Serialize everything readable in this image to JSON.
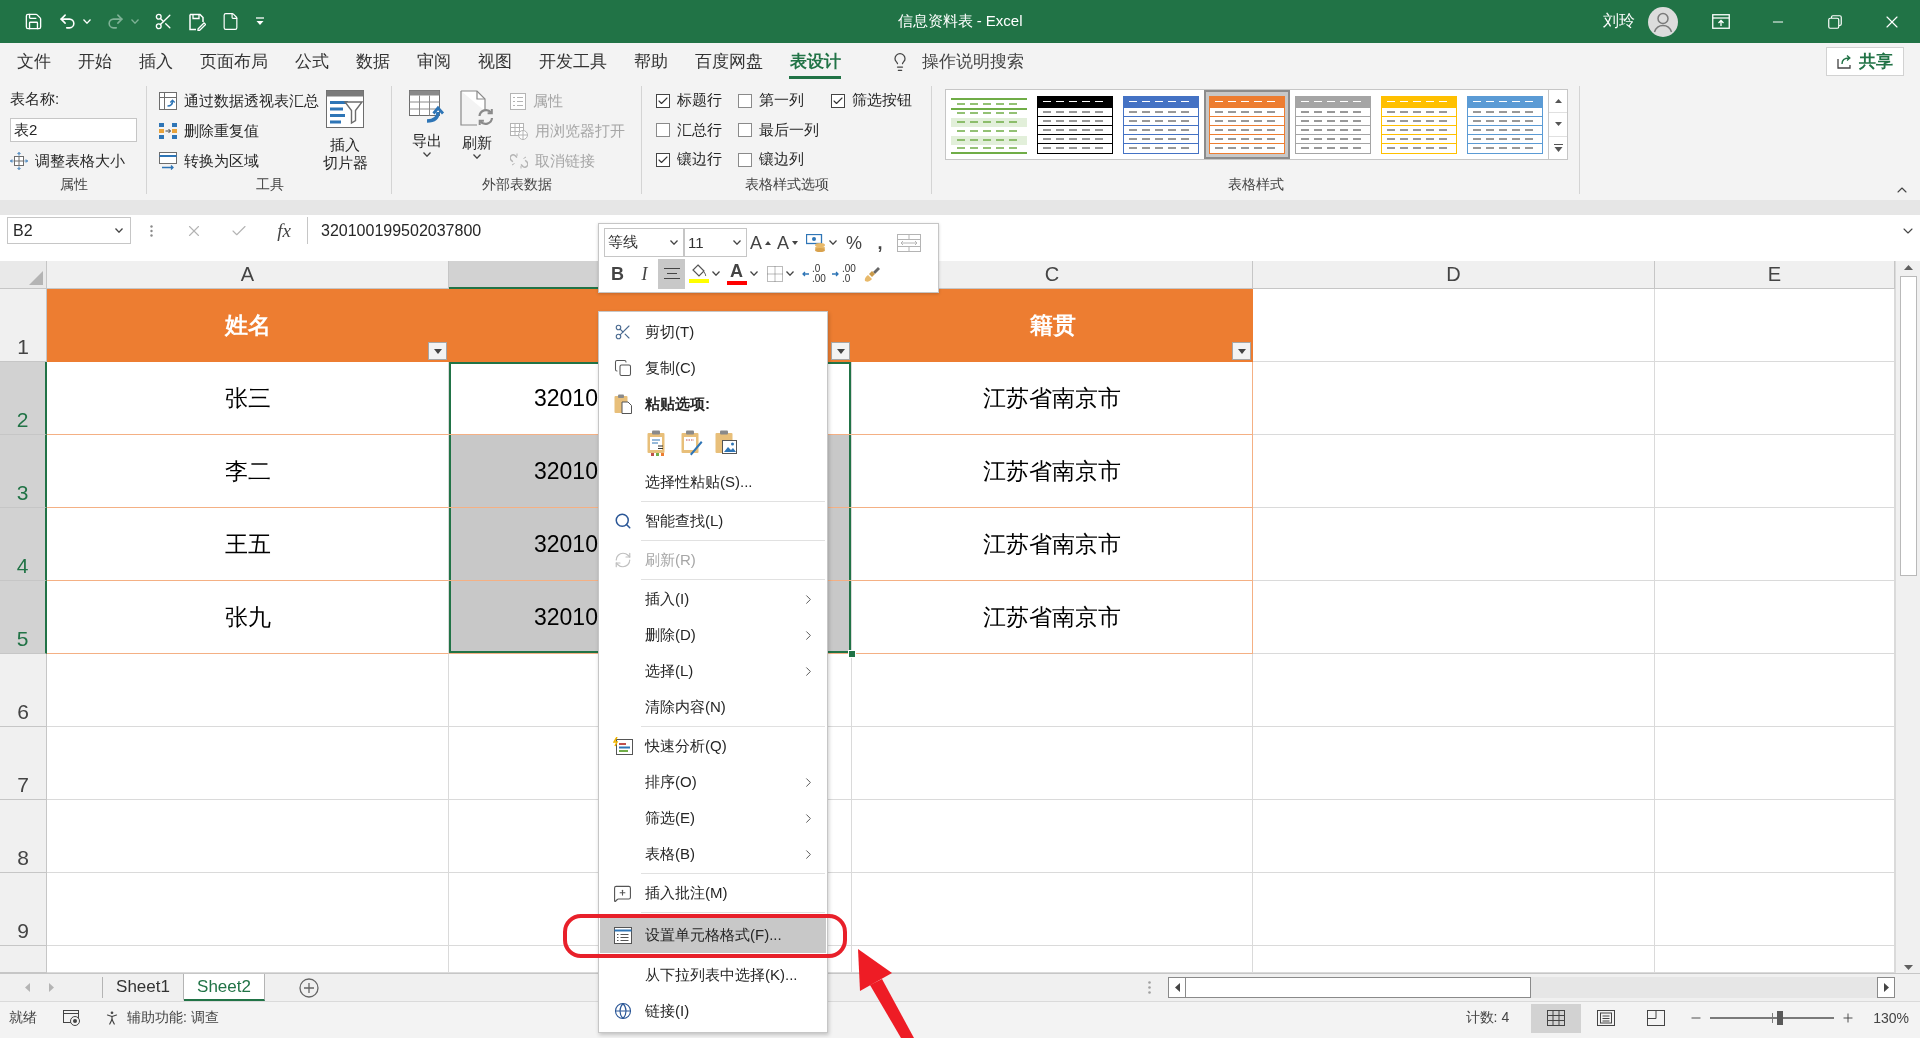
{
  "title_bar": {
    "quick_access": [
      {
        "kind": "save",
        "disabled": false
      },
      {
        "kind": "undo",
        "disabled": false
      },
      {
        "kind": "redo",
        "disabled": true
      },
      {
        "kind": "cut",
        "disabled": false
      },
      {
        "kind": "save_as",
        "disabled": false
      },
      {
        "kind": "new",
        "disabled": false
      },
      {
        "kind": "customize",
        "disabled": false
      }
    ],
    "title": "信息资料表 - Excel",
    "user": "刘玲"
  },
  "ribbon_tabs": [
    {
      "label": "文件",
      "selected": false
    },
    {
      "label": "开始",
      "selected": false
    },
    {
      "label": "插入",
      "selected": false
    },
    {
      "label": "页面布局",
      "selected": false
    },
    {
      "label": "公式",
      "selected": false
    },
    {
      "label": "数据",
      "selected": false
    },
    {
      "label": "审阅",
      "selected": false
    },
    {
      "label": "视图",
      "selected": false
    },
    {
      "label": "开发工具",
      "selected": false
    },
    {
      "label": "帮助",
      "selected": false
    },
    {
      "label": "百度网盘",
      "selected": false
    },
    {
      "label": "表设计",
      "selected": true
    }
  ],
  "tell_me": "操作说明搜索",
  "share": "共享",
  "ribbon": {
    "properties": {
      "label": "属性",
      "name_label": "表名称:",
      "name_value": "表2",
      "resize": "调整表格大小"
    },
    "tools": {
      "label": "工具",
      "buttons": [
        {
          "kind": "pivot",
          "label": "通过数据透视表汇总"
        },
        {
          "kind": "dedupe",
          "label": "删除重复值"
        },
        {
          "kind": "convert",
          "label": "转换为区域"
        }
      ],
      "slicer": [
        "插入",
        "切片器"
      ]
    },
    "external": {
      "label": "外部表数据",
      "large": [
        {
          "kind": "export",
          "label": "导出"
        },
        {
          "kind": "refresh",
          "label": "刷新"
        }
      ],
      "small": [
        {
          "kind": "properties",
          "label": "属性",
          "disabled": true
        },
        {
          "kind": "browser",
          "label": "用浏览器打开",
          "disabled": true
        },
        {
          "kind": "unlink",
          "label": "取消链接",
          "disabled": true
        }
      ]
    },
    "style_options": {
      "label": "表格样式选项",
      "columns": [
        [
          {
            "label": "标题行",
            "checked": true
          },
          {
            "label": "汇总行",
            "checked": false
          },
          {
            "label": "镶边行",
            "checked": true
          }
        ],
        [
          {
            "label": "第一列",
            "checked": false
          },
          {
            "label": "最后一列",
            "checked": false
          },
          {
            "label": "镶边列",
            "checked": false
          }
        ],
        [
          {
            "label": "筛选按钮",
            "checked": true
          }
        ]
      ]
    },
    "styles": {
      "label": "表格样式",
      "items": [
        {
          "kind": "light",
          "color": "#70ad47",
          "selected": false
        },
        {
          "kind": "medium",
          "color": "#000000",
          "selected": false
        },
        {
          "kind": "medium",
          "color": "#4472c4",
          "selected": false
        },
        {
          "kind": "medium",
          "color": "#ed7d31",
          "selected": true
        },
        {
          "kind": "medium",
          "color": "#a5a5a5",
          "selected": false
        },
        {
          "kind": "medium",
          "color": "#ffc000",
          "selected": false
        },
        {
          "kind": "medium",
          "color": "#5b9bd5",
          "selected": false
        }
      ]
    }
  },
  "formula_bar": {
    "name_box": "B2",
    "fx": "fx",
    "formula": "320100199502037800"
  },
  "mini_toolbar": {
    "font": "等线",
    "size": "11",
    "row_1": [
      {
        "kind": "grow_font",
        "text": "A"
      },
      {
        "kind": "shrink_font",
        "text": "A"
      },
      {
        "kind": "accounting"
      },
      {
        "kind": "percent",
        "text": "%"
      },
      {
        "kind": "comma",
        "text": ","
      },
      {
        "kind": "merge"
      }
    ],
    "row_2": [
      {
        "kind": "bold",
        "text": "B",
        "on": false
      },
      {
        "kind": "italic",
        "text": "I",
        "on": false
      },
      {
        "kind": "align_center",
        "on": true
      },
      {
        "kind": "fill_color",
        "color": "#ffff00",
        "on": false
      },
      {
        "kind": "font_color",
        "text": "A",
        "color": "#ff0000",
        "on": false
      },
      {
        "kind": "borders",
        "on": false
      },
      {
        "kind": "increase_decimal",
        "lines": [
          ".0",
          ".00"
        ],
        "on": false
      },
      {
        "kind": "decrease_decimal",
        "lines": [
          ".00",
          ".0"
        ],
        "on": false
      },
      {
        "kind": "format_painter",
        "on": false
      }
    ]
  },
  "sheet": {
    "columns": [
      {
        "label": "A",
        "selected": false
      },
      {
        "selected": true
      },
      {
        "label": "C",
        "selected": false
      },
      {
        "label": "D",
        "selected": false
      },
      {
        "label": "E",
        "selected": false
      }
    ],
    "row_headers": [
      {
        "label": "1",
        "selected": false
      },
      {
        "label": "2",
        "selected": true
      },
      {
        "label": "3",
        "selected": true
      },
      {
        "label": "4",
        "selected": true
      },
      {
        "label": "5",
        "selected": true
      },
      {
        "label": "6",
        "selected": false
      },
      {
        "label": "7",
        "selected": false
      },
      {
        "label": "8",
        "selected": false
      },
      {
        "label": "9",
        "selected": false
      }
    ],
    "table": {
      "header": [
        {
          "text": "姓名",
          "filter_button": true
        },
        {
          "filter_button": true
        },
        {
          "text": "籍贯",
          "filter_button": true
        }
      ],
      "rows": [
        {
          "cells": [
            {
              "text": "张三",
              "selected": false,
              "active": false
            },
            {
              "text": "32010",
              "selected": true,
              "active": true
            },
            {
              "text": "江苏省南京市",
              "selected": false,
              "active": false
            }
          ]
        },
        {
          "cells": [
            {
              "text": "李二",
              "selected": false,
              "active": false
            },
            {
              "text": "32010",
              "selected": true,
              "active": false
            },
            {
              "text": "江苏省南京市",
              "selected": false,
              "active": false
            }
          ]
        },
        {
          "cells": [
            {
              "text": "王五",
              "selected": false,
              "active": false
            },
            {
              "text": "32010",
              "selected": true,
              "active": false
            },
            {
              "text": "江苏省南京市",
              "selected": false,
              "active": false
            }
          ]
        },
        {
          "cells": [
            {
              "text": "张九",
              "selected": false,
              "active": false
            },
            {
              "text": "32010",
              "selected": true,
              "active": false
            },
            {
              "text": "江苏省南京市",
              "selected": false,
              "active": false
            }
          ]
        }
      ]
    }
  },
  "context_menu": {
    "groups": [
      [
        {
          "kind": "cut",
          "label": "剪切(T)",
          "submenu": false,
          "disabled": false,
          "selected": false
        },
        {
          "kind": "copy",
          "label": "复制(C)",
          "submenu": false,
          "disabled": false,
          "selected": false
        },
        {
          "kind": "paste_heading",
          "label": "粘贴选项:"
        },
        {
          "kind": "paste_options",
          "options": [
            {
              "kind": "values"
            },
            {
              "kind": "formatting"
            },
            {
              "kind": "picture"
            }
          ]
        },
        {
          "kind": "plain",
          "label": "选择性粘贴(S)...",
          "submenu": false,
          "disabled": false,
          "selected": false
        }
      ],
      [
        {
          "kind": "lookup",
          "label": "智能查找(L)",
          "submenu": false,
          "disabled": false,
          "selected": false
        }
      ],
      [
        {
          "kind": "refresh",
          "label": "刷新(R)",
          "submenu": false,
          "disabled": true,
          "selected": false
        }
      ],
      [
        {
          "kind": "plain",
          "label": "插入(I)",
          "submenu": true,
          "disabled": false,
          "selected": false
        },
        {
          "kind": "plain",
          "label": "删除(D)",
          "submenu": true,
          "disabled": false,
          "selected": false
        },
        {
          "kind": "plain",
          "label": "选择(L)",
          "submenu": true,
          "disabled": false,
          "selected": false
        },
        {
          "kind": "plain",
          "label": "清除内容(N)",
          "submenu": false,
          "disabled": false,
          "selected": false
        }
      ],
      [
        {
          "kind": "analysis",
          "label": "快速分析(Q)",
          "submenu": false,
          "disabled": false,
          "selected": false
        },
        {
          "kind": "plain",
          "label": "排序(O)",
          "submenu": true,
          "disabled": false,
          "selected": false
        },
        {
          "kind": "plain",
          "label": "筛选(E)",
          "submenu": true,
          "disabled": false,
          "selected": false
        },
        {
          "kind": "plain",
          "label": "表格(B)",
          "submenu": true,
          "disabled": false,
          "selected": false
        }
      ],
      [
        {
          "kind": "comment",
          "label": "插入批注(M)",
          "submenu": false,
          "disabled": false,
          "selected": false
        }
      ],
      [
        {
          "kind": "format",
          "label": "设置单元格格式(F)...",
          "submenu": false,
          "disabled": false,
          "selected": true
        },
        {
          "kind": "plain",
          "label": "从下拉列表中选择(K)...",
          "submenu": false,
          "disabled": false,
          "selected": false
        },
        {
          "kind": "link",
          "label": "链接(I)",
          "submenu": false,
          "disabled": false,
          "selected": false
        }
      ]
    ]
  },
  "sheet_tabs": [
    {
      "label": "Sheet1",
      "selected": false
    },
    {
      "label": "Sheet2",
      "selected": true
    }
  ],
  "status_bar": {
    "ready": "就绪",
    "accessibility": "辅助功能: 调查",
    "count": "计数: 4",
    "views": [
      {
        "kind": "normal",
        "selected": true
      },
      {
        "kind": "page_layout",
        "selected": false
      },
      {
        "kind": "page_break",
        "selected": false
      }
    ],
    "zoom": {
      "level": 0.56,
      "reading": "130%"
    }
  }
}
